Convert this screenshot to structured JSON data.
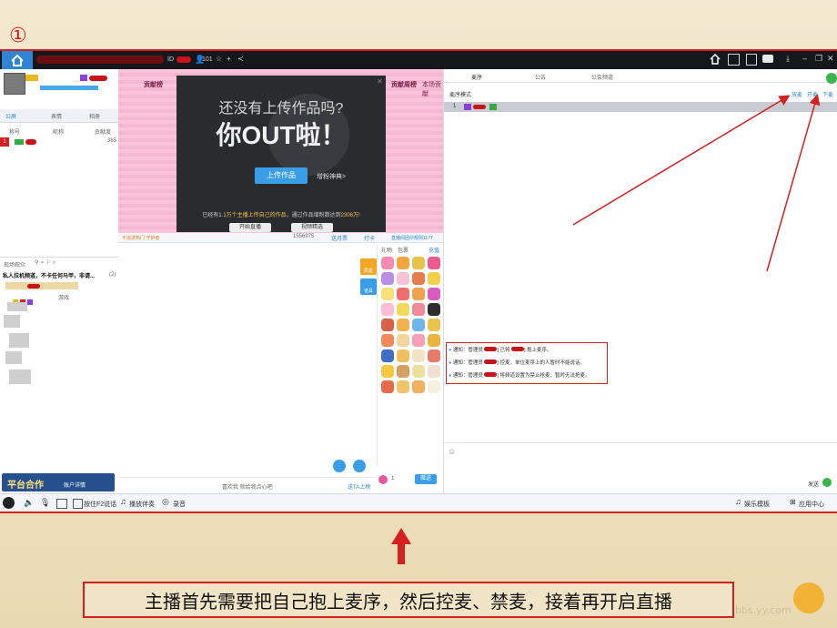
{
  "step_marker": "①",
  "topbar": {
    "id_label": "ID",
    "count": "101"
  },
  "left": {
    "tabs": [
      "公屏",
      "表情",
      "相册"
    ],
    "list_headers": [
      "称号",
      "昵称",
      "贡献度"
    ],
    "list_row": {
      "rank": "1",
      "value": "365"
    },
    "lounge_title": "现场观众",
    "banner_text": "私人拉机频道，不卡任何马甲，非请...",
    "banner_tag": "(2)",
    "user_tag": "游戏",
    "ad_text": "平台合作",
    "ad_sub": "账户详情"
  },
  "center": {
    "left_tab": "贡献榜",
    "right_tab": "贡献周榜",
    "right_tab2": "本场贡献",
    "popup": {
      "question": "还没有上传作品吗?",
      "headline": "你OUT啦！",
      "upload_button": "上传作品",
      "tips_link": "增粉神典>",
      "info_line1": "已经有1.",
      "info_highlight": "1万个主播上传自己的作品",
      "info_line2": "，通过作品增粉数达到",
      "info_count": "2306万",
      "info_end": "!",
      "start_button": "开始直播",
      "video_button": "视频精选"
    },
    "status_left": "不追求热门 守护者",
    "fans_count": "1556975",
    "follow": "送月票",
    "punch": "打卡",
    "fan_club": "直播间团伙规则1177",
    "gift_tabs": [
      "礼物",
      "包裹"
    ],
    "recharge": "充值",
    "side_buttons": [
      "周星",
      "道具"
    ],
    "chat_placeholder": "喜欢我 就给我点心吧",
    "send_ta": "送TA上榜",
    "gift_qty": "1",
    "gift_send": "赠送"
  },
  "right": {
    "tabs": [
      "麦序",
      "公告",
      "公会频道"
    ],
    "mode": "麦序模式",
    "mic_actions": [
      "放麦",
      "开麦",
      "下麦"
    ],
    "queue_rank": "1",
    "notices": [
      {
        "prefix": "通知：管理员",
        "msg": "] 已将",
        "tail": "] 抱上麦序。"
      },
      {
        "prefix": "通知：管理员",
        "msg": "] 控麦，单位麦序上的人暂时不能说话。",
        "tail": ""
      },
      {
        "prefix": "通知：管理员",
        "msg": "] 将频道设置为禁止抢麦，暂时无法抢麦。",
        "tail": ""
      }
    ],
    "send": "发送"
  },
  "bottombar": {
    "hold_talk": "按住F2说话",
    "music": "播放伴奏",
    "record": "录音",
    "entertainment": "娱乐模板",
    "app_center": "应用中心"
  },
  "caption": "主播首先需要把自己抱上麦序，然后控麦、禁麦，接着再开启直播",
  "watermark": "bbs.yy.com",
  "colors": {
    "accent_red": "#d42020",
    "yy_blue": "#2f84d6",
    "popup_bg": "#2a2b2f",
    "pink": "#f7b4d2"
  }
}
